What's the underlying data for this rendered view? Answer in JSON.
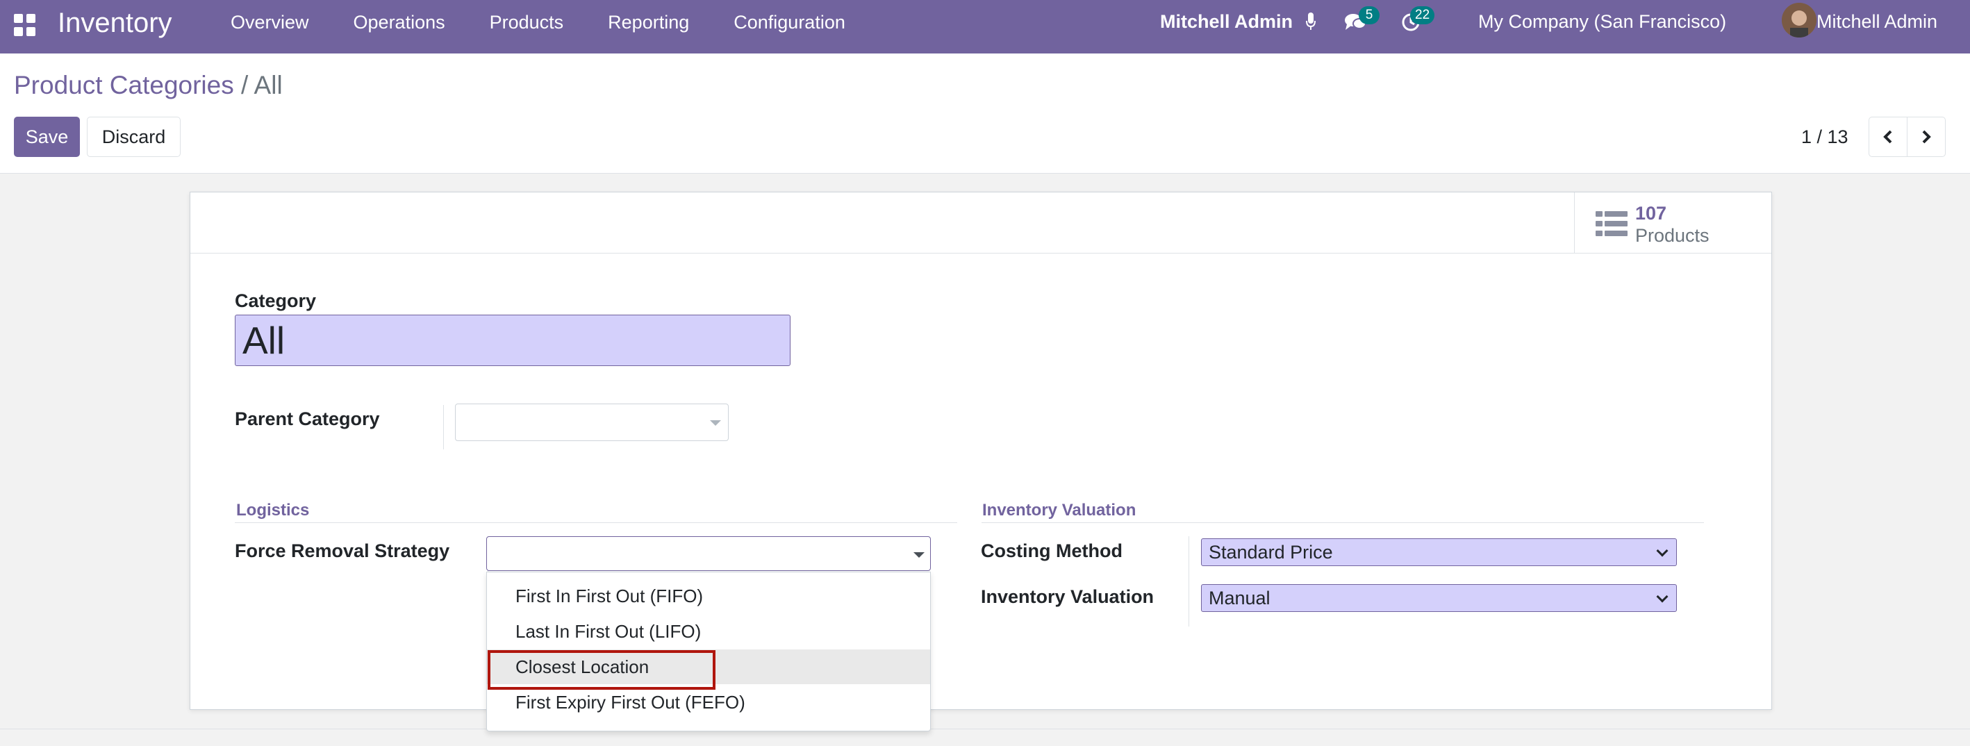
{
  "navbar": {
    "app_title": "Inventory",
    "menu": [
      "Overview",
      "Operations",
      "Products",
      "Reporting",
      "Configuration"
    ],
    "status_user": "Mitchell Admin",
    "chat_count": "5",
    "activity_count": "22",
    "company": "My Company (San Francisco)",
    "user": "Mitchell Admin"
  },
  "breadcrumb": {
    "parent": "Product Categories",
    "separator": "/",
    "current": "All"
  },
  "actions": {
    "save": "Save",
    "discard": "Discard"
  },
  "pager": {
    "value": "1 / 13"
  },
  "smart_button": {
    "value": "107",
    "label": "Products"
  },
  "form": {
    "category_label": "Category",
    "category_value": "All",
    "parent_label": "Parent Category",
    "parent_value": "",
    "logistics_title": "Logistics",
    "removal_label": "Force Removal Strategy",
    "removal_value": "",
    "valuation_title": "Inventory Valuation",
    "costing_label": "Costing Method",
    "costing_value": "Standard Price",
    "valuation_label": "Inventory Valuation",
    "valuation_value": "Manual"
  },
  "dropdown": {
    "options": [
      "First In First Out (FIFO)",
      "Last In First Out (LIFO)",
      "Closest Location",
      "First Expiry First Out (FEFO)"
    ],
    "highlighted": "Closest Location"
  },
  "colors": {
    "brand": "#71639e",
    "badge": "#017e84",
    "field_bg": "#d4d0fb",
    "highlight_border": "#b0160e"
  }
}
